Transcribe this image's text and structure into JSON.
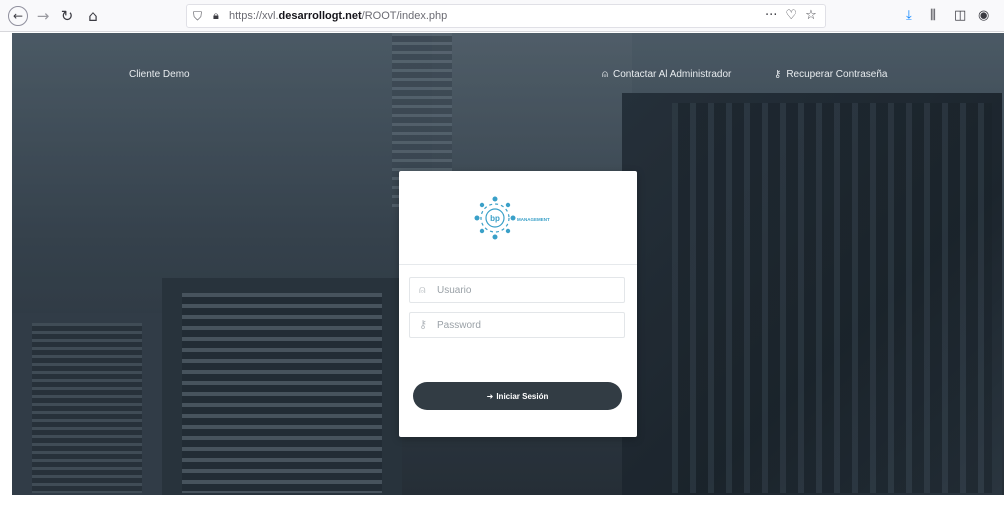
{
  "browser": {
    "url_prefix": "https://xvl.",
    "url_domain": "desarrollogt.net",
    "url_path": "/ROOT/index.php",
    "icons": [
      "back-icon",
      "forward-icon",
      "reload-icon",
      "home-icon",
      "shield-icon",
      "lock-icon",
      "more-icon",
      "pocket-icon",
      "bookmark-star-icon",
      "download-icon",
      "library-icon",
      "sidebar-icon",
      "account-icon"
    ]
  },
  "header": {
    "client_name": "Cliente Demo",
    "contact_admin": "Contactar Al Administrador",
    "recover_password": "Recuperar Contraseña"
  },
  "login": {
    "logo_text": "MANAGEMENT",
    "username_placeholder": "Usuario",
    "password_placeholder": "Password",
    "submit_label": "Iniciar Sesión"
  },
  "colors": {
    "button": "#323c44",
    "logo_accent": "#3aa0c8"
  }
}
